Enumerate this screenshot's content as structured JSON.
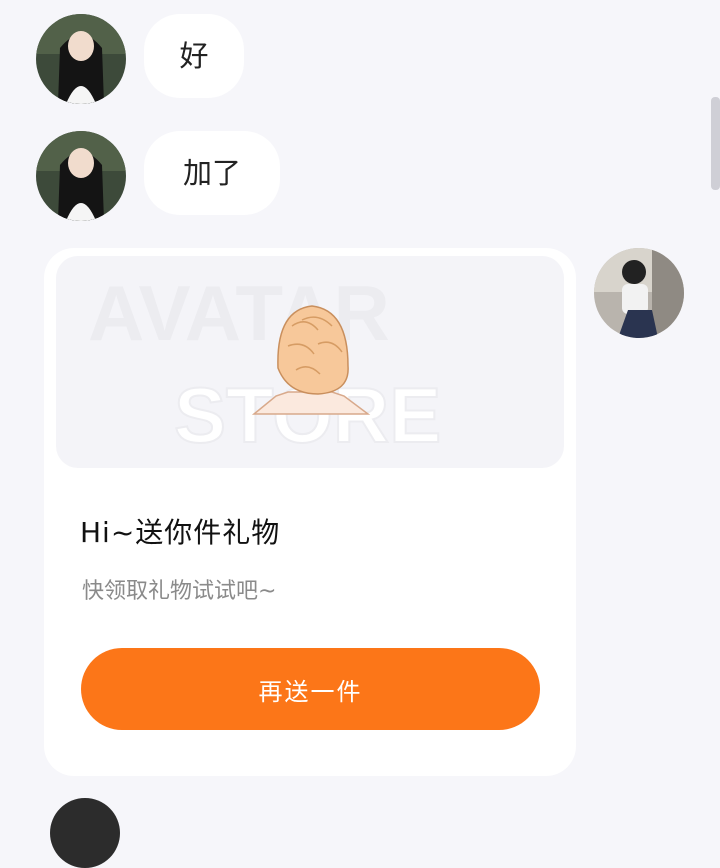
{
  "messages": [
    {
      "sender": "contact",
      "text": "好"
    },
    {
      "sender": "contact",
      "text": "加了"
    }
  ],
  "gift_card": {
    "watermark_line1": "AVATAR",
    "watermark_line2": "STORE",
    "title": "Hi~送你件礼物",
    "subtitle": "快领取礼物试试吧~",
    "button_label": "再送一件"
  },
  "colors": {
    "background": "#f6f6fa",
    "bubble": "#ffffff",
    "button": "#fc7618"
  }
}
